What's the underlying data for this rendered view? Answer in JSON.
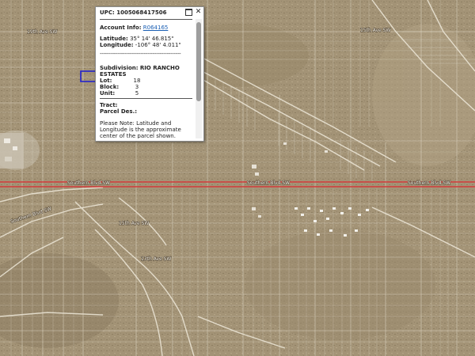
{
  "popup": {
    "upc_label": "UPC:",
    "upc_value": "1005068417506",
    "account_label": "Account Info:",
    "account_value": "R064165",
    "latitude_label": "Latitude:",
    "latitude_value": "35° 14' 46.815\"",
    "longitude_label": "Longitude:",
    "longitude_value": "-106° 48' 4.011\"",
    "dash_separator": "----------------------------------------------",
    "subdivision_label": "Subdivision:",
    "subdivision_value_1": "RIO RANCHO",
    "subdivision_value_2": "ESTATES",
    "fields": [
      {
        "label": "Lot:",
        "value": "18"
      },
      {
        "label": "Block:",
        "value": "3"
      },
      {
        "label": "Unit:",
        "value": "5"
      }
    ],
    "tract_label": "Tract:",
    "parcel_label": "Parcel Des.:",
    "note": "Please Note: Latitude and Longitude is the approximate center of the parcel shown.",
    "maximize_icon": "maximize-icon",
    "close_icon": "close-icon",
    "close_glyph": "✕"
  },
  "map": {
    "road_labels": [
      "19th Ave SW",
      "15th Ave SW",
      "Southern Blvd SW",
      "Southern Blvd SW",
      "Southern Blvd SW",
      "15th Ave SW",
      "13th Ave SW",
      "Southern Blvd SW"
    ],
    "colors": {
      "boulevard": "#d23a3a",
      "parcel_lines": "#e9e4d6",
      "selected_parcel": "#2222cc",
      "terrain": "#a39376"
    }
  }
}
